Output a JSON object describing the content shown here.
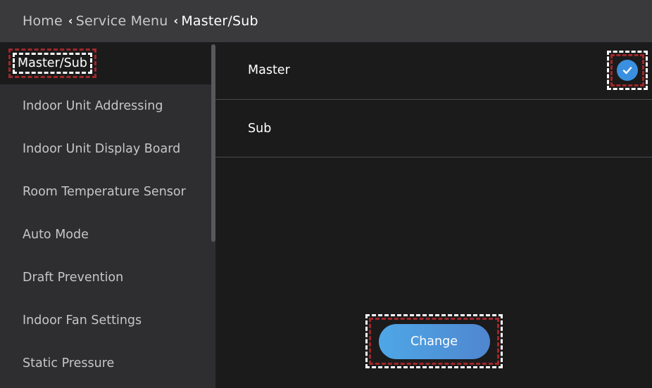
{
  "breadcrumb": {
    "items": [
      "Home",
      "Service Menu",
      "Master/Sub"
    ]
  },
  "sidebar": {
    "items": [
      {
        "label": "Master/Sub"
      },
      {
        "label": "Indoor Unit Addressing"
      },
      {
        "label": "Indoor Unit Display Board"
      },
      {
        "label": "Room Temperature Sensor"
      },
      {
        "label": "Auto Mode"
      },
      {
        "label": "Draft Prevention"
      },
      {
        "label": "Indoor Fan Settings"
      },
      {
        "label": "Static Pressure"
      }
    ]
  },
  "options": {
    "master": {
      "label": "Master",
      "selected": true
    },
    "sub": {
      "label": "Sub",
      "selected": false
    }
  },
  "actions": {
    "change_label": "Change"
  },
  "colors": {
    "accent": "#3b8fe0",
    "button_start": "#4ea7e6",
    "button_end": "#4f86cf",
    "header_bg": "#3a3a3d",
    "sidebar_bg": "#2e2e31",
    "main_bg": "#1b1b1c",
    "highlight_dash": "#a12628"
  },
  "icons": {
    "breadcrumb_separator": "chevron-left-icon",
    "selected_marker": "check-circle-icon"
  }
}
